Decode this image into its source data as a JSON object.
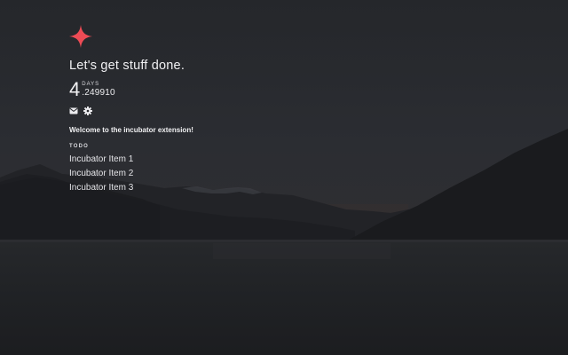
{
  "brand": {
    "logo_icon": "four-point-star-icon",
    "accent_color": "#ee4b55"
  },
  "tagline": "Let's get stuff done.",
  "counter": {
    "value": "4",
    "unit": "DAYS",
    "fraction": ".249910"
  },
  "actions": {
    "mail_icon": "mail-icon",
    "settings_icon": "gear-icon"
  },
  "welcome_message": "Welcome to the incubator extension!",
  "todo": {
    "heading": "TODO",
    "items": [
      {
        "label": "Incubator Item 1"
      },
      {
        "label": "Incubator Item 2"
      },
      {
        "label": "Incubator Item 3"
      }
    ]
  }
}
